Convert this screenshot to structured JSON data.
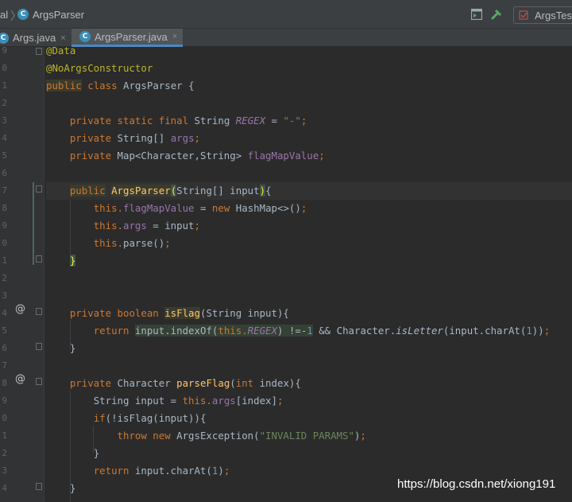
{
  "navbar": {
    "crumb_partial": "al",
    "crumb_class": "ArgsParser",
    "class_icon_letter": "C",
    "run_config": "ArgsTest"
  },
  "tabs": [
    {
      "label": "Args.java",
      "close": "×",
      "active": false
    },
    {
      "label": "ArgsParser.java",
      "close": "×",
      "active": true
    }
  ],
  "gutter": {
    "line_numbers": [
      "9",
      "0",
      "1",
      "2",
      "3",
      "4",
      "5",
      "6",
      "7",
      "8",
      "9",
      "0",
      "1",
      "2",
      "3",
      "4",
      "5",
      "6",
      "7",
      "8",
      "9",
      "0",
      "1",
      "2",
      "3",
      "4"
    ],
    "override_marker": "@"
  },
  "code": {
    "l0": "@Data",
    "l1": "@NoArgsConstructor",
    "l2_public": "public",
    "l2_class": "class",
    "l2_name": "ArgsParser",
    "l2_brace": "{",
    "l4_mods": "private static final",
    "l4_type": "String",
    "l4_name": "REGEX",
    "l4_eq": "=",
    "l4_val": "\"-\"",
    "l4_semi": ";",
    "l5_mods": "private",
    "l5_type": "String[]",
    "l5_name": "args",
    "l5_semi": ";",
    "l6_mods": "private",
    "l6_type": "Map<Character,String>",
    "l6_name": "flagMapValue",
    "l6_semi": ";",
    "l8_public": "public",
    "l8_name": "ArgsParser",
    "l8_open": "(",
    "l8_params": "String[] input",
    "l8_close": ")",
    "l8_brace": "{",
    "l9_this": "this.",
    "l9_field": "flagMapValue",
    "l9_eq": " = ",
    "l9_new": "new",
    "l9_rest": " HashMap<>()",
    "l9_semi": ";",
    "l10_this": "this.",
    "l10_field": "args",
    "l10_rest": " = input",
    "l10_semi": ";",
    "l11_this": "this.",
    "l11_rest": "parse()",
    "l11_semi": ";",
    "l12_brace": "}",
    "l15_mods": "private boolean",
    "l15_name": "isFlag",
    "l15_params": "(String input){",
    "l16_return": "return",
    "l16_hl": "input.indexOf(",
    "l16_this": "this.",
    "l16_regex": "REGEX",
    "l16_hl2": ") !=-",
    "l16_one": "1",
    "l16_rest1": " && Character.",
    "l16_isletter": "isLetter",
    "l16_rest2": "(input.charAt(",
    "l16_one2": "1",
    "l16_rest3": "))",
    "l16_semi": ";",
    "l17_brace": "}",
    "l19_mods": "private",
    "l19_type": "Character",
    "l19_name": "parseFlag",
    "l19_open": "(",
    "l19_int": "int",
    "l19_rest": " index){",
    "l20_type": "String input = ",
    "l20_this": "this.",
    "l20_field": "args",
    "l20_rest": "[index]",
    "l20_semi": ";",
    "l21_if": "if",
    "l21_rest": "(!isFlag(input)){",
    "l22_throw": "throw new",
    "l22_rest": " ArgsException(",
    "l22_str": "\"INVALID PARAMS\"",
    "l22_close": ")",
    "l22_semi": ";",
    "l23_brace": "}",
    "l24_return": "return",
    "l24_rest": " input.charAt(",
    "l24_num": "1",
    "l24_close": ")",
    "l24_semi": ";",
    "l25_brace": "}"
  },
  "watermark": "https://blog.csdn.net/xiong191"
}
